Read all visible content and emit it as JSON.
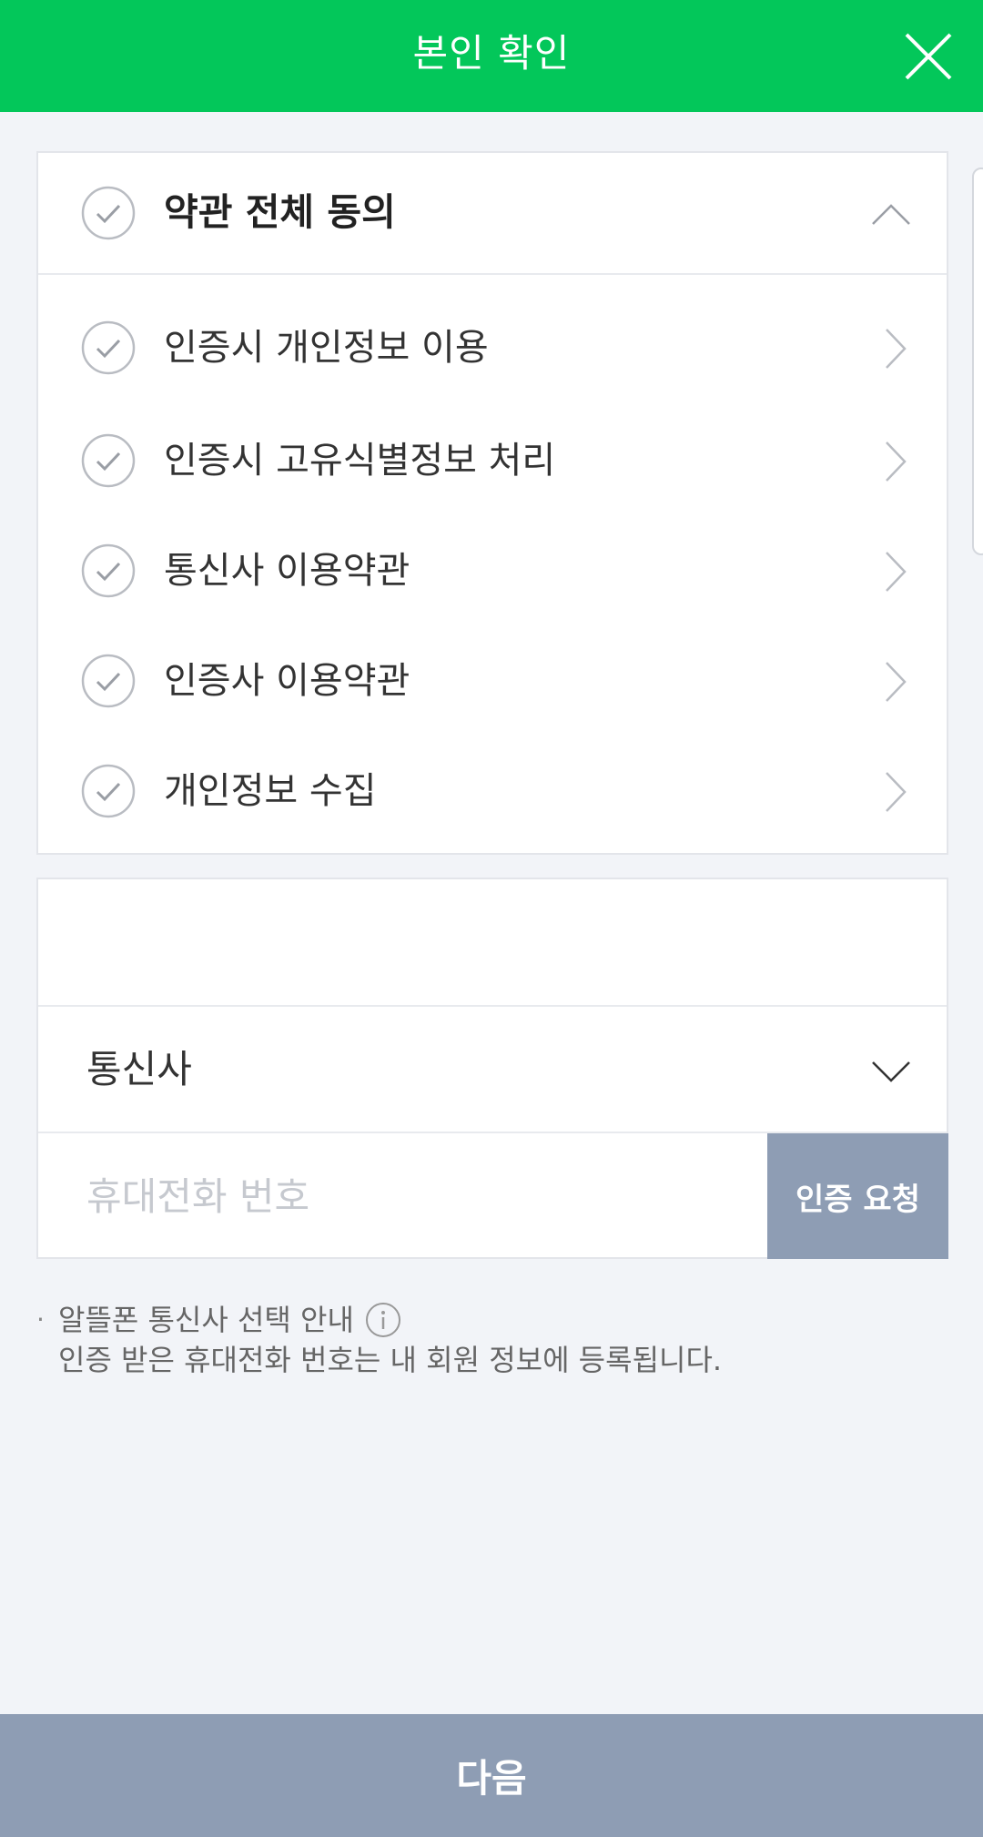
{
  "header": {
    "title": "본인 확인"
  },
  "terms": {
    "all_label": "약관 전체 동의",
    "items": [
      {
        "label": "인증시 개인정보 이용"
      },
      {
        "label": "인증시 고유식별정보 처리"
      },
      {
        "label": "통신사 이용약관"
      },
      {
        "label": "인증사 이용약관"
      },
      {
        "label": "개인정보 수집"
      }
    ]
  },
  "phone": {
    "carrier_label": "통신사",
    "phone_placeholder": "휴대전화 번호",
    "verify_button": "인증 요청"
  },
  "notice": {
    "bullet": "·",
    "line1": "알뜰폰 통신사 선택 안내",
    "line2": "인증 받은 휴대전화 번호는 내 회원 정보에 등록됩니다."
  },
  "footer": {
    "next_button": "다음"
  },
  "colors": {
    "header_bg": "#03c75a",
    "button_bg": "#8e9db4",
    "page_bg": "#f2f4f8"
  },
  "icons": {
    "close": "close-icon",
    "check": "check-circle-icon",
    "chevron_up": "chevron-up-icon",
    "chevron_right": "chevron-right-icon",
    "chevron_down": "chevron-down-icon",
    "info": "info-icon"
  }
}
